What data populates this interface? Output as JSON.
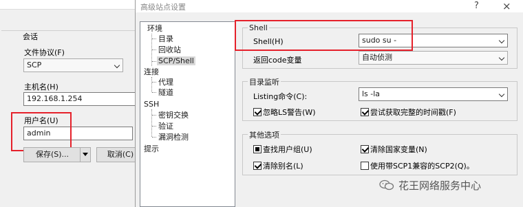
{
  "back_panel": {
    "section_label": "会话",
    "protocol_label": "文件协议(F)",
    "protocol_value": "SCP",
    "host_label": "主机名(H)",
    "host_value": "192.168.1.254",
    "user_label": "用户名(U)",
    "user_value": "admin",
    "save_button": "保存(S)...",
    "cancel_button": "取消(C)"
  },
  "dialog": {
    "title": "高级站点设置",
    "help": "?",
    "close": "×",
    "tree": {
      "env": "环境",
      "dir": "目录",
      "recycle": "回收站",
      "scp_shell": "SCP/Shell",
      "connection": "连接",
      "proxy": "代理",
      "tunnel": "隧道",
      "ssh": "SSH",
      "kex": "密钥交换",
      "auth": "验证",
      "bugs": "漏洞检测",
      "note": "提示"
    },
    "shell_group": {
      "title": "Shell",
      "shell_label": "Shell(H)",
      "shell_value": "sudo su -",
      "return_label": "返回code变量",
      "return_value": "自动侦测"
    },
    "dir_group": {
      "title": "目录监听",
      "listing_label": "Listing命令(C):",
      "listing_value": "ls -la",
      "ignore_ls_warn": "忽略LS警告(W)",
      "try_full_time": "尝试获取完整的时间戳(F)"
    },
    "other_group": {
      "title": "其他选项",
      "lookup_groups": "查找用户组(U)",
      "clear_national": "清除国家变量(N)",
      "clear_alias": "清除别名(L)",
      "scp2_compat": "使用带SCP1兼容的SCP2(Q)。"
    }
  },
  "watermark": "花王网络服务中心",
  "colors": {
    "highlight": "#e5202a",
    "window_bg": "#f0f0f0"
  }
}
